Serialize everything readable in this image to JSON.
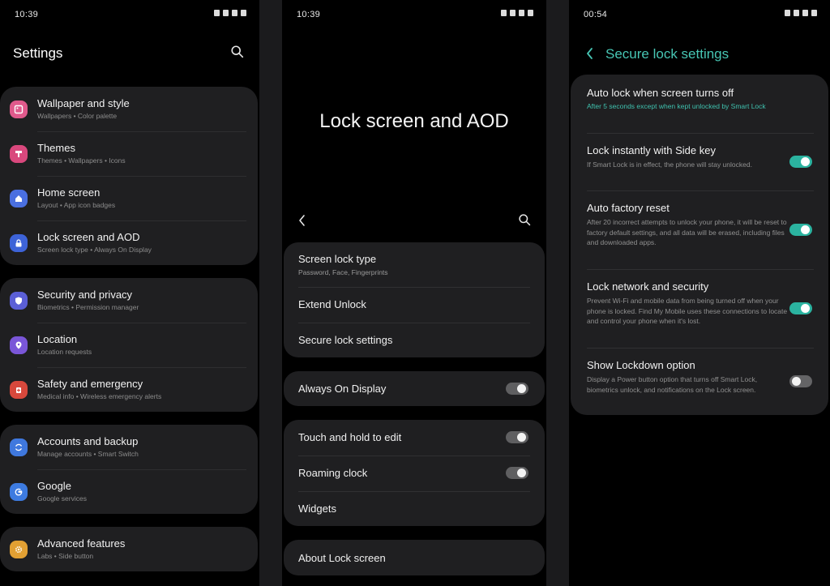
{
  "panel1": {
    "time": "10:39",
    "title": "Settings",
    "groups": [
      [
        {
          "title": "Wallpaper and style",
          "subtitle": "Wallpapers • Color palette",
          "icon": "wallpaper-icon",
          "color": "#e05a8c"
        },
        {
          "title": "Themes",
          "subtitle": "Themes • Wallpapers • Icons",
          "icon": "themes-icon",
          "color": "#d9487d"
        },
        {
          "title": "Home screen",
          "subtitle": "Layout • App icon badges",
          "icon": "home-icon",
          "color": "#4a6fe0"
        },
        {
          "title": "Lock screen and AOD",
          "subtitle": "Screen lock type • Always On Display",
          "icon": "lock-icon",
          "color": "#3d63d8"
        }
      ],
      [
        {
          "title": "Security and privacy",
          "subtitle": "Biometrics • Permission manager",
          "icon": "shield-icon",
          "color": "#5b5fd6"
        },
        {
          "title": "Location",
          "subtitle": "Location requests",
          "icon": "location-pin-icon",
          "color": "#7a56d8"
        },
        {
          "title": "Safety and emergency",
          "subtitle": "Medical info • Wireless emergency alerts",
          "icon": "emergency-icon",
          "color": "#d8483c"
        }
      ],
      [
        {
          "title": "Accounts and backup",
          "subtitle": "Manage accounts • Smart Switch",
          "icon": "sync-icon",
          "color": "#3f78de"
        },
        {
          "title": "Google",
          "subtitle": "Google services",
          "icon": "google-icon",
          "color": "#3d7be0"
        }
      ],
      [
        {
          "title": "Advanced features",
          "subtitle": "Labs • Side button",
          "icon": "gear-icon",
          "color": "#e2a033"
        }
      ]
    ]
  },
  "panel2": {
    "time": "10:39",
    "title": "Lock screen and AOD",
    "card1": [
      {
        "title": "Screen lock type",
        "subtitle": "Password, Face, Fingerprints"
      },
      {
        "title": "Extend Unlock"
      },
      {
        "title": "Secure lock settings"
      }
    ],
    "always_on": {
      "title": "Always On Display",
      "toggle": "off"
    },
    "card3": [
      {
        "title": "Touch and hold to edit",
        "toggle": "off"
      },
      {
        "title": "Roaming clock",
        "toggle": "off"
      },
      {
        "title": "Widgets"
      }
    ],
    "about": {
      "title": "About Lock screen"
    }
  },
  "panel3": {
    "time": "00:54",
    "title": "Secure lock settings",
    "accent_color": "#47c6b4",
    "items": [
      {
        "title": "Auto lock when screen turns off",
        "desc": "After 5 seconds except when kept unlocked by Smart Lock"
      },
      {
        "title": "Lock instantly with Side key",
        "desc": "If Smart Lock is in effect, the phone will stay unlocked.",
        "toggle": "on"
      },
      {
        "title": "Auto factory reset",
        "desc": "After 20 incorrect attempts to unlock your phone, it will be reset to factory default settings, and all data will be erased, including files and downloaded apps.",
        "toggle": "on"
      },
      {
        "title": "Lock network and security",
        "desc": "Prevent Wi-Fi and mobile data from being turned off when your phone is locked. Find My Mobile uses these connections to locate and control your phone when it's lost.",
        "toggle": "on"
      },
      {
        "title": "Show Lockdown option",
        "desc": "Display a Power button option that turns off Smart Lock, biometrics unlock, and notifications on the Lock screen.",
        "toggle": "off"
      }
    ]
  }
}
